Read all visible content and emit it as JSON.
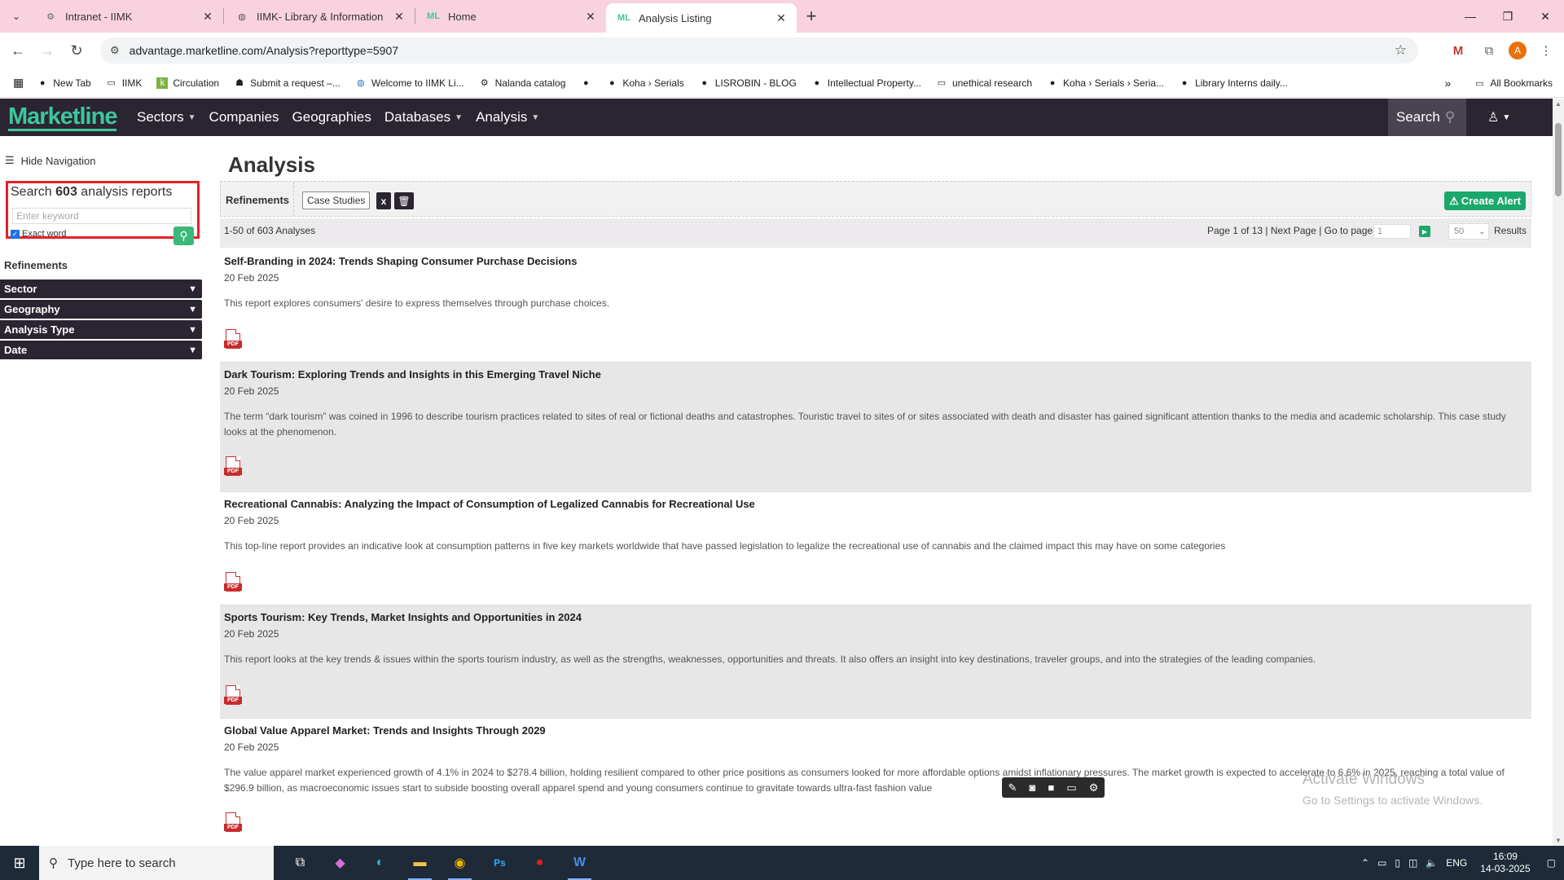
{
  "browser": {
    "tabs": [
      {
        "label": "Intranet - IIMK",
        "icon": "gear-favicon"
      },
      {
        "label": "IIMK- Library & Information Ce",
        "icon": "globe-favicon"
      },
      {
        "label": "Home",
        "icon": "marketline-favicon"
      },
      {
        "label": "Analysis Listing",
        "icon": "marketline-favicon"
      }
    ],
    "url": "advantage.marketline.com/Analysis?reporttype=5907",
    "profile_initial": "A",
    "bookmarks": [
      "New Tab",
      "IIMK",
      "Circulation",
      "Submit a request –...",
      "Welcome to IIMK Li...",
      "Nalanda catalog",
      "",
      "Koha › Serials",
      "LISROBIN - BLOG",
      "Intellectual Property...",
      "unethical research",
      "Koha › Serials › Seria...",
      "Library Interns daily..."
    ],
    "all_bookmarks": "All Bookmarks",
    "more_bookmarks": "»"
  },
  "site": {
    "logo": "Marketline",
    "nav": [
      "Sectors",
      "Companies",
      "Geographies",
      "Databases",
      "Analysis"
    ],
    "search_label": "Search",
    "accent": "#3cc79b",
    "nav_bg": "#2b2532"
  },
  "sidebar": {
    "hide_nav": "Hide Navigation",
    "search_prefix": "Search ",
    "search_count": "603",
    "search_suffix": " analysis reports",
    "keyword_placeholder": "Enter keyword",
    "exact_word": "Exact word",
    "refinements": "Refinements",
    "facets": [
      "Sector",
      "Geography",
      "Analysis Type",
      "Date"
    ]
  },
  "main": {
    "title": "Analysis",
    "refinements_label": "Refinements",
    "chip": "Case Studies",
    "chip_remove": "x",
    "create_alert": "Create Alert",
    "count": "1-50 of 603 Analyses",
    "paging": "Page 1 of 13 | Next Page | Go to page",
    "page_input": "1",
    "per_page": "50",
    "results_label": "Results",
    "pdf_label": "PDF",
    "results": [
      {
        "title": "Self-Branding in 2024: Trends Shaping Consumer Purchase Decisions",
        "date": "20 Feb 2025",
        "desc": "This report explores consumers' desire to express themselves through purchase choices."
      },
      {
        "title": "Dark Tourism: Exploring Trends and Insights in this Emerging Travel Niche",
        "date": "20 Feb 2025",
        "desc": "The term “dark tourism” was coined in 1996 to describe tourism practices related to sites of real or fictional deaths and catastrophes. Touristic travel to sites of or sites associated with death and disaster has gained significant attention thanks to the media and academic scholarship. This case study looks at the phenomenon."
      },
      {
        "title": "Recreational Cannabis: Analyzing the Impact of Consumption of Legalized Cannabis for Recreational Use",
        "date": "20 Feb 2025",
        "desc": "This top-line report provides an indicative look at consumption patterns in five key markets worldwide that have passed legislation to legalize the recreational use of cannabis and the claimed impact this may have on some categories"
      },
      {
        "title": "Sports Tourism: Key Trends, Market Insights and Opportunities in 2024",
        "date": "20 Feb 2025",
        "desc": "This report looks at the key trends & issues within the sports tourism industry, as well as the strengths, weaknesses, opportunities and threats. It also offers an insight into key destinations, traveler groups, and into the strategies of the leading companies."
      },
      {
        "title": "Global Value Apparel Market: Trends and Insights Through 2029",
        "date": "20 Feb 2025",
        "desc": "The value apparel market experienced growth of 4.1% in 2024 to $278.4 billion, holding resilient compared to other price positions as consumers looked for more affordable options amidst inflationary pressures. The market growth is expected to accelerate to 6.6% in 2025, reaching a total value of $296.9 billion, as macroeconomic issues start to subside boosting overall apparel spend and young consumers continue to gravitate towards ultra-fast fashion value"
      }
    ]
  },
  "watermark": {
    "line1": "Activate Windows",
    "line2": "Go to Settings to activate Windows."
  },
  "taskbar": {
    "search_placeholder": "Type here to search",
    "lang": "ENG",
    "time": "16:09",
    "date": "14-03-2025"
  }
}
